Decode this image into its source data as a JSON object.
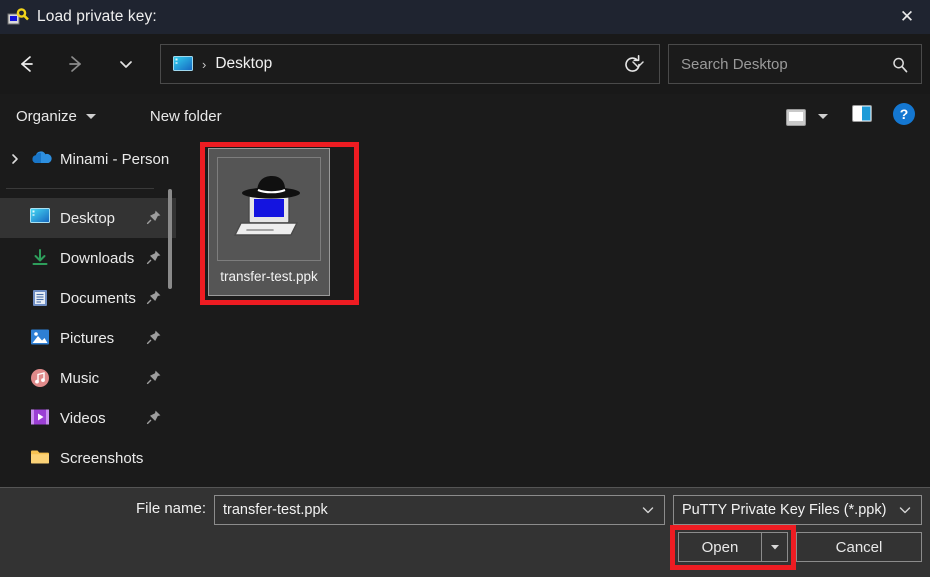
{
  "window": {
    "title": "Load private key:",
    "title_icon": "putty-key-icon",
    "close_label": "✕",
    "titlebar_color": "#1f2430"
  },
  "navbar": {
    "back_icon": "←",
    "forward_icon": "→",
    "recent_icon": "∨",
    "up_icon": "↑",
    "breadcrumb_icon": "desktop-icon",
    "breadcrumb_separator": "›",
    "breadcrumb": "Desktop",
    "address_chevron": "∨",
    "refresh_icon": "refresh-icon"
  },
  "search": {
    "placeholder": "Search Desktop",
    "icon": "search-icon"
  },
  "toolbar": {
    "organize_label": "Organize",
    "new_folder_label": "New folder",
    "view_icon": "view-options-icon",
    "view_caret": "▾",
    "preview_icon": "preview-pane-icon",
    "help_icon": "help-icon",
    "help_glyph": "?"
  },
  "sidebar": {
    "scroll_thumb": true,
    "items": [
      {
        "label": "Minami - Person",
        "icon": "onedrive-cloud-icon",
        "expander": "›",
        "pinned": false,
        "selected": false
      },
      {
        "label": "Desktop",
        "icon": "desktop-folder-icon",
        "expander": "",
        "pinned": true,
        "selected": true
      },
      {
        "label": "Downloads",
        "icon": "downloads-icon",
        "expander": "",
        "pinned": true,
        "selected": false
      },
      {
        "label": "Documents",
        "icon": "documents-icon",
        "expander": "",
        "pinned": true,
        "selected": false
      },
      {
        "label": "Pictures",
        "icon": "pictures-icon",
        "expander": "",
        "pinned": true,
        "selected": false
      },
      {
        "label": "Music",
        "icon": "music-icon",
        "expander": "",
        "pinned": true,
        "selected": false
      },
      {
        "label": "Videos",
        "icon": "videos-icon",
        "expander": "",
        "pinned": true,
        "selected": false
      },
      {
        "label": "Screenshots",
        "icon": "folder-icon",
        "expander": "",
        "pinned": false,
        "selected": false
      }
    ]
  },
  "filelist": {
    "files": [
      {
        "name": "transfer-test.ppk",
        "icon": "putty-ppk-icon",
        "selected": true,
        "highlighted": true
      }
    ]
  },
  "footer": {
    "filename_label": "File name:",
    "filename_value": "transfer-test.ppk",
    "filename_chevron": "∨",
    "filetype_value": "PuTTY Private Key Files (*.ppk)",
    "filetype_chevron": "∨",
    "open_label": "Open",
    "open_split_caret": "▾",
    "cancel_label": "Cancel"
  },
  "annotations": {
    "color": "#ee1c22",
    "boxes": [
      "selected-file-box",
      "open-button-box"
    ]
  }
}
